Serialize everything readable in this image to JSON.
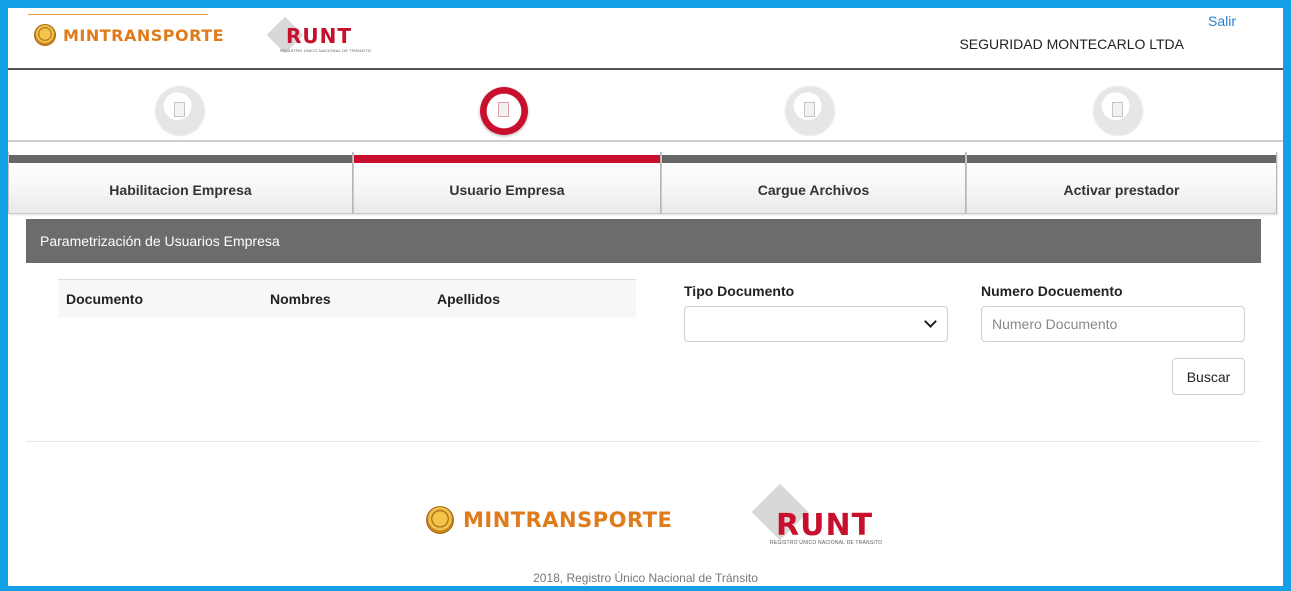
{
  "header": {
    "mintransporte_logo": "MINTRANSPORTE",
    "runt_logo": "RUNT",
    "runt_subtitle": "REGISTRO ÚNICO NACIONAL DE TRÁNSITO",
    "logout_label": "Salir",
    "company_name": "SEGURIDAD MONTECARLO LTDA"
  },
  "steps": [
    {
      "label": "Habilitacion Empresa",
      "active": false
    },
    {
      "label": "Usuario Empresa",
      "active": true
    },
    {
      "label": "Cargue Archivos",
      "active": false
    },
    {
      "label": "Activar prestador",
      "active": false
    }
  ],
  "panel": {
    "title": "Parametrización de Usuarios Empresa",
    "table_headers": [
      "Documento",
      "Nombres",
      "Apellidos"
    ],
    "tipo_documento_label": "Tipo Documento",
    "tipo_documento_value": "",
    "numero_documento_label": "Numero Docuemento",
    "numero_documento_placeholder": "Numero Documento",
    "search_label": "Buscar"
  },
  "footer": {
    "mintransporte_logo": "MINTRANSPORTE",
    "runt_logo": "RUNT",
    "runt_subtitle": "REGISTRO ÚNICO NACIONAL DE TRÁNSITO",
    "copyright": "2018, Registro Único Nacional de Tránsito"
  },
  "colors": {
    "accent_red": "#c8102e",
    "frame_blue": "#14a0e6",
    "panel_header": "#6c6c6c",
    "mintransporte_orange": "#e07b1c"
  }
}
